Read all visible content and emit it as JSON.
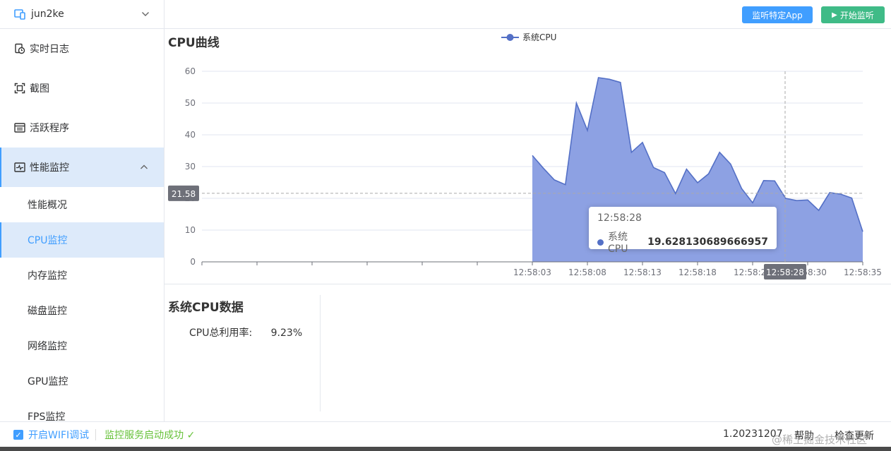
{
  "sidebar": {
    "device": "jun2ke",
    "menu": [
      {
        "label": "实时日志",
        "icon": "log-clock-icon"
      },
      {
        "label": "截图",
        "icon": "screenshot-icon"
      },
      {
        "label": "活跃程序",
        "icon": "app-list-icon"
      },
      {
        "label": "性能监控",
        "icon": "performance-icon",
        "expanded": true
      }
    ],
    "sub_items": [
      "性能概况",
      "CPU监控",
      "内存监控",
      "磁盘监控",
      "网络监控",
      "GPU监控",
      "FPS监控"
    ],
    "active_sub": "CPU监控"
  },
  "toolbar": {
    "listen_app_label": "监听特定App",
    "start_label": "开始监听"
  },
  "chart": {
    "title": "CPU曲线"
  },
  "chart_data": {
    "type": "area",
    "title": "CPU曲线",
    "legend": [
      "系统CPU"
    ],
    "legend_position": "top-center",
    "ylim": [
      0,
      60
    ],
    "yticks": [
      0,
      10,
      20,
      30,
      40,
      50,
      60
    ],
    "x_tick_labels": [
      "12:58:03",
      "12:58:08",
      "12:58:13",
      "12:58:18",
      "12:58:23",
      "12:58:30",
      "12:58:35"
    ],
    "grid": true,
    "color": "#5470c6",
    "series": [
      {
        "name": "系统CPU",
        "values": [
          33.5,
          29.5,
          25.8,
          24.3,
          50.0,
          41.4,
          58.0,
          57.5,
          56.5,
          34.5,
          37.6,
          29.7,
          28.1,
          21.5,
          29.2,
          24.9,
          27.7,
          34.5,
          30.8,
          23.1,
          18.6,
          25.6,
          25.5,
          20.0,
          19.3,
          19.5,
          16.2,
          21.8,
          21.3,
          20.1,
          9.5
        ]
      }
    ],
    "crosshair": {
      "y_label": "21.58",
      "x_label": "12:58:28"
    }
  },
  "tooltip": {
    "time": "12:58:28",
    "series_name": "系统CPU",
    "value": "19.628130689666957"
  },
  "data_panel": {
    "title": "系统CPU数据",
    "label": "CPU总利用率:",
    "value": "9.23%"
  },
  "statusbar": {
    "wifi_label": "开启WIFI调试",
    "service_status": "监控服务启动成功",
    "version": "1.20231207",
    "help": "帮助",
    "update": "检查更新"
  },
  "watermark": "@稀土掘金技术社区"
}
